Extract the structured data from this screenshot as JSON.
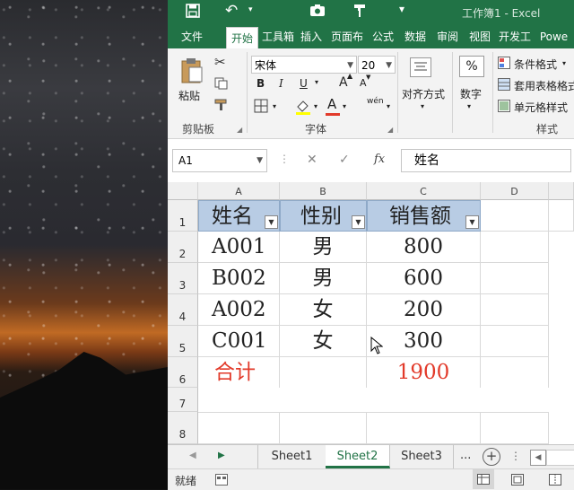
{
  "title_bar": {
    "doc_title": "工作簿1 - Excel",
    "icons": [
      "save-icon",
      "undo-icon",
      "undo-dropdown-icon",
      "camera-icon",
      "format-painter-icon",
      "customize-qat-icon"
    ]
  },
  "ribbon_tabs": [
    "文件",
    "开始",
    "工具箱",
    "插入",
    "页面布",
    "公式",
    "数据",
    "审阅",
    "视图",
    "开发工",
    "Powe"
  ],
  "active_tab": "开始",
  "clipboard": {
    "paste_label": "粘贴",
    "group_label": "剪贴板"
  },
  "font": {
    "name": "宋体",
    "size": "20",
    "bold": "B",
    "italic": "I",
    "underline": "U",
    "grow": "A",
    "shrink": "A",
    "phonetic": "wén",
    "font_color_letter": "A",
    "group_label": "字体"
  },
  "alignment": {
    "label": "对齐方式"
  },
  "number": {
    "label": "数字",
    "percent": "%"
  },
  "styles": {
    "items": [
      "条件格式",
      "套用表格格式",
      "单元格样式"
    ],
    "group_label": "样式"
  },
  "formula_bar": {
    "name_box": "A1",
    "cancel": "✕",
    "enter": "✓",
    "fx": "fx",
    "content": "姓名"
  },
  "columns": [
    "A",
    "B",
    "C",
    "D"
  ],
  "rows": [
    "1",
    "2",
    "3",
    "4",
    "5",
    "6",
    "7",
    "8"
  ],
  "table": {
    "headers": [
      "姓名",
      "性别",
      "销售额"
    ],
    "rows": [
      [
        "A001",
        "男",
        "800"
      ],
      [
        "B002",
        "男",
        "600"
      ],
      [
        "A002",
        "女",
        "200"
      ],
      [
        "C001",
        "女",
        "300"
      ]
    ],
    "total_label": "合计",
    "total_value": "1900"
  },
  "sheets": [
    "Sheet1",
    "Sheet2",
    "Sheet3"
  ],
  "active_sheet": "Sheet2",
  "sheet_more": "...",
  "status": {
    "ready": "就绪"
  },
  "colors": {
    "excel_green": "#217346",
    "header_fill": "#b8cce4",
    "total_red": "#e23a2a"
  }
}
